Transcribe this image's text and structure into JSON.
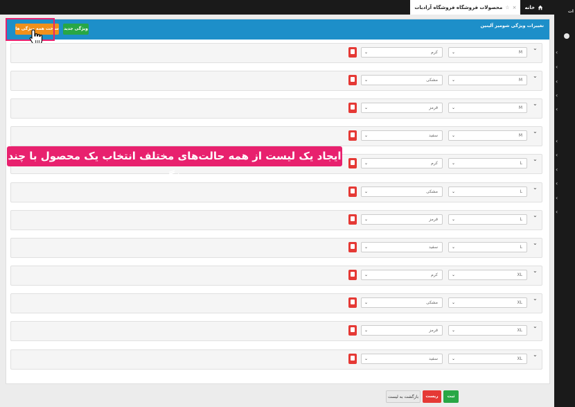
{
  "topbar": {
    "home_tab": "خانه",
    "products_tab": "محصولات فروشگاه فروشگاه آرادبات",
    "right_text": "ات"
  },
  "panel": {
    "title": "تغییرات ویژگی شومیز آلینین",
    "new_button": "ویژگی جدید",
    "build_button": "ساخت همه ویژگی ها"
  },
  "banner": "ایجاد یک لیست از همه حالت‌های مختلف انتخاب یک محصول با چند ویژگی",
  "rows": [
    {
      "size": "M",
      "color": "کرم"
    },
    {
      "size": "M",
      "color": "مشکی"
    },
    {
      "size": "M",
      "color": "قرمز"
    },
    {
      "size": "M",
      "color": "سفید"
    },
    {
      "size": "L",
      "color": "کرم"
    },
    {
      "size": "L",
      "color": "مشکی"
    },
    {
      "size": "L",
      "color": "قرمز"
    },
    {
      "size": "L",
      "color": "سفید"
    },
    {
      "size": "XL",
      "color": "کرم"
    },
    {
      "size": "XL",
      "color": "مشکی"
    },
    {
      "size": "XL",
      "color": "قرمز"
    },
    {
      "size": "XL",
      "color": "سفید"
    }
  ],
  "footer": {
    "submit": "ثبت",
    "reset": "ریست",
    "back": "بازگشت به لیست"
  },
  "colors": {
    "header_blue": "#1d8fc9",
    "new_green": "#28a745",
    "build_orange": "#f0901b",
    "highlight_pink": "#e8216e",
    "delete_red": "#e53935"
  },
  "icons": {
    "home": "home-icon",
    "star": "star-icon",
    "close": "close-icon",
    "cursor": "hand-cursor-icon",
    "delete": "trash-icon"
  }
}
